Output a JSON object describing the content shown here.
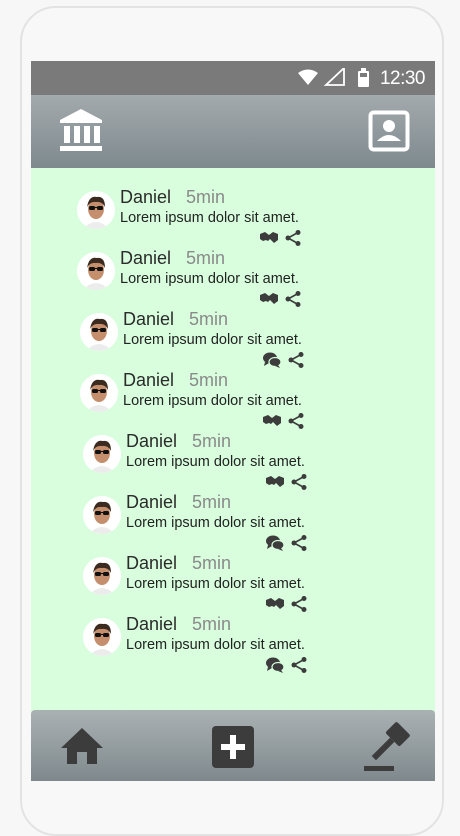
{
  "status_bar": {
    "time": "12:30",
    "icons": [
      "wifi-icon",
      "signal-icon",
      "battery-icon"
    ]
  },
  "app_bar": {
    "left_icon": "bank-icon",
    "right_icon": "profile-icon"
  },
  "feed": {
    "posts": [
      {
        "author": "Daniel",
        "time": "5min",
        "text": "Lorem ipsum dolor sit amet.",
        "action_icon": "handshake-icon"
      },
      {
        "author": "Daniel",
        "time": "5min",
        "text": "Lorem ipsum dolor sit amet.",
        "action_icon": "handshake-icon"
      },
      {
        "author": "Daniel",
        "time": "5min",
        "text": "Lorem ipsum dolor sit amet.",
        "action_icon": "comments-icon"
      },
      {
        "author": "Daniel",
        "time": "5min",
        "text": "Lorem ipsum dolor sit amet.",
        "action_icon": "handshake-icon"
      },
      {
        "author": "Daniel",
        "time": "5min",
        "text": "Lorem ipsum dolor sit amet.",
        "action_icon": "handshake-icon"
      },
      {
        "author": "Daniel",
        "time": "5min",
        "text": "Lorem ipsum dolor sit amet.",
        "action_icon": "comments-icon"
      },
      {
        "author": "Daniel",
        "time": "5min",
        "text": "Lorem ipsum dolor sit amet.",
        "action_icon": "handshake-icon"
      },
      {
        "author": "Daniel",
        "time": "5min",
        "text": "Lorem ipsum dolor sit amet.",
        "action_icon": "comments-icon"
      }
    ]
  },
  "bottom_bar": {
    "icons": [
      "home-icon",
      "add-icon",
      "gavel-icon"
    ]
  },
  "colors": {
    "feed_background": "#d8fedd",
    "bar_gradient_top": "#a3aaad",
    "bar_gradient_bottom": "#7e898e",
    "status_bar": "#7a7a7a",
    "icon_dark": "#3c3c3c"
  }
}
